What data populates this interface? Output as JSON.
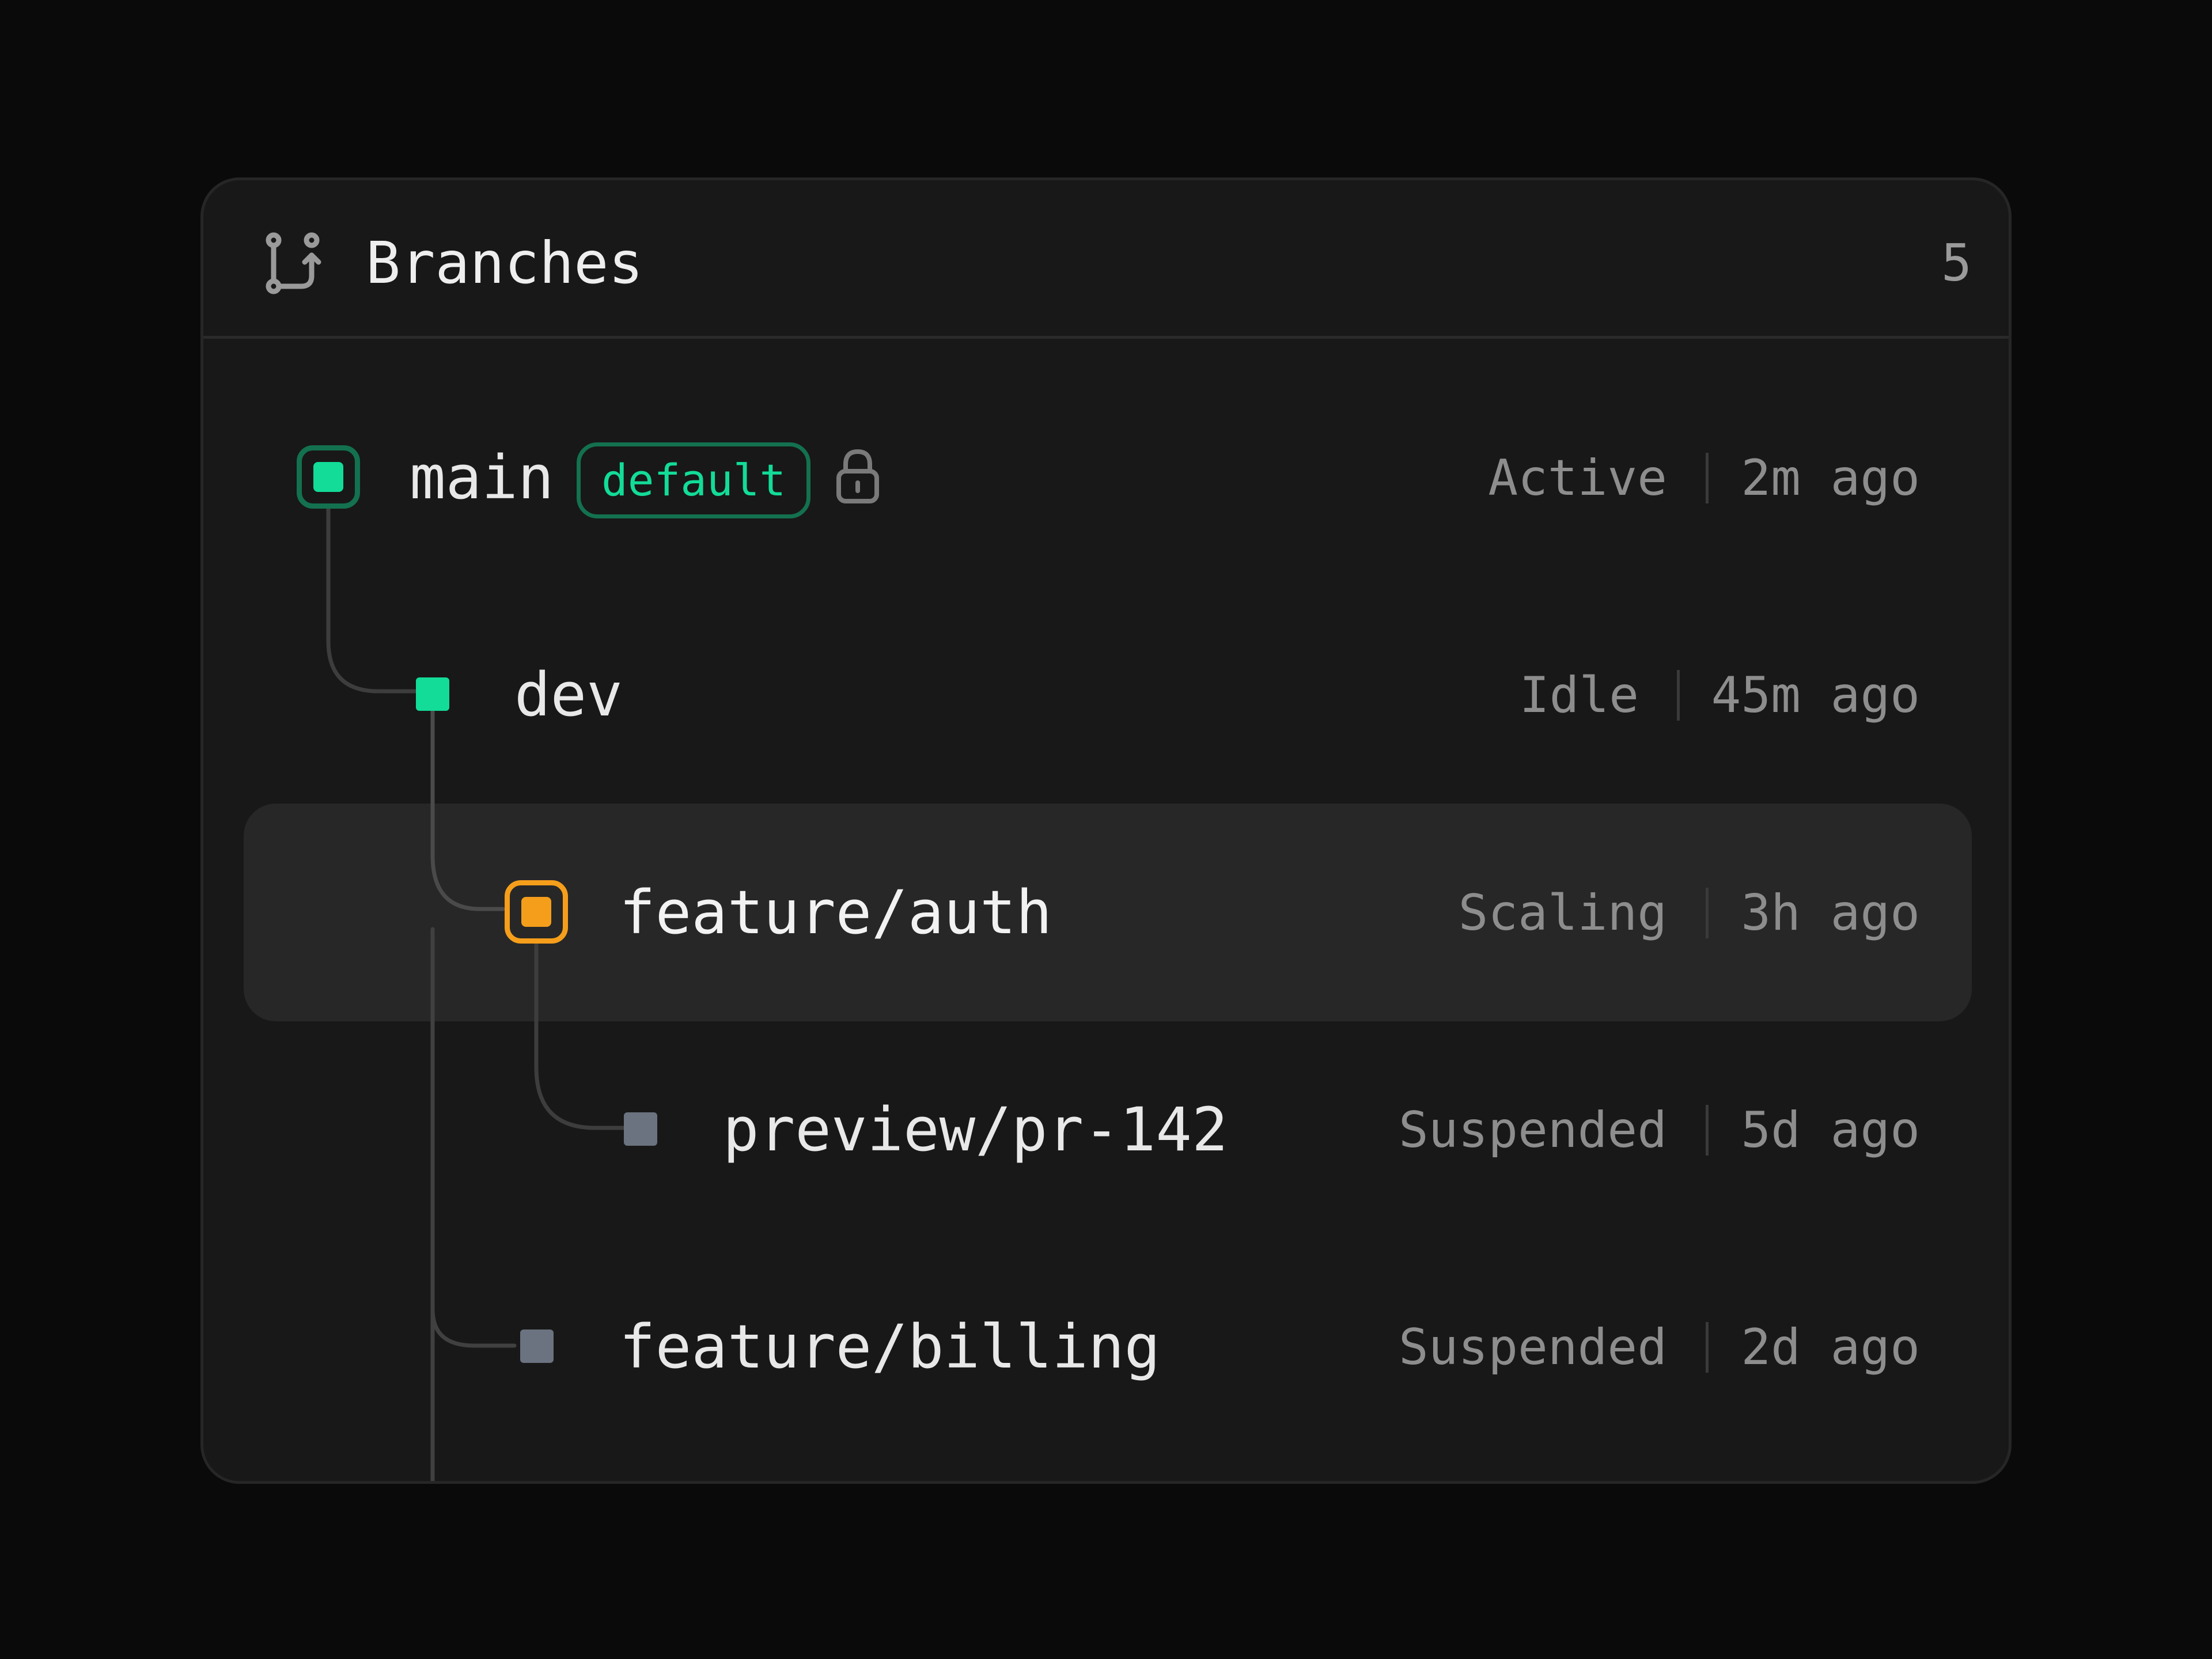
{
  "header": {
    "title": "Branches",
    "count": "5",
    "icon": "git-branch-icon"
  },
  "colors": {
    "active": "#12dc98",
    "active_border": "#13714f",
    "scaling": "#f59e1b",
    "suspended": "#6b7280"
  },
  "branches": [
    {
      "name": "main",
      "badge": "default",
      "locked": true,
      "status": "Active",
      "updated": "2m ago",
      "state_color": "#12dc98"
    },
    {
      "name": "dev",
      "status": "Idle",
      "updated": "45m ago",
      "state_color": "#12dc98"
    },
    {
      "name": "feature/auth",
      "status": "Scaling",
      "updated": "3h ago",
      "state_color": "#f59e1b",
      "selected": true
    },
    {
      "name": "preview/pr-142",
      "status": "Suspended",
      "updated": "5d ago",
      "state_color": "#6b7280"
    },
    {
      "name": "feature/billing",
      "status": "Suspended",
      "updated": "2d ago",
      "state_color": "#6b7280"
    }
  ]
}
